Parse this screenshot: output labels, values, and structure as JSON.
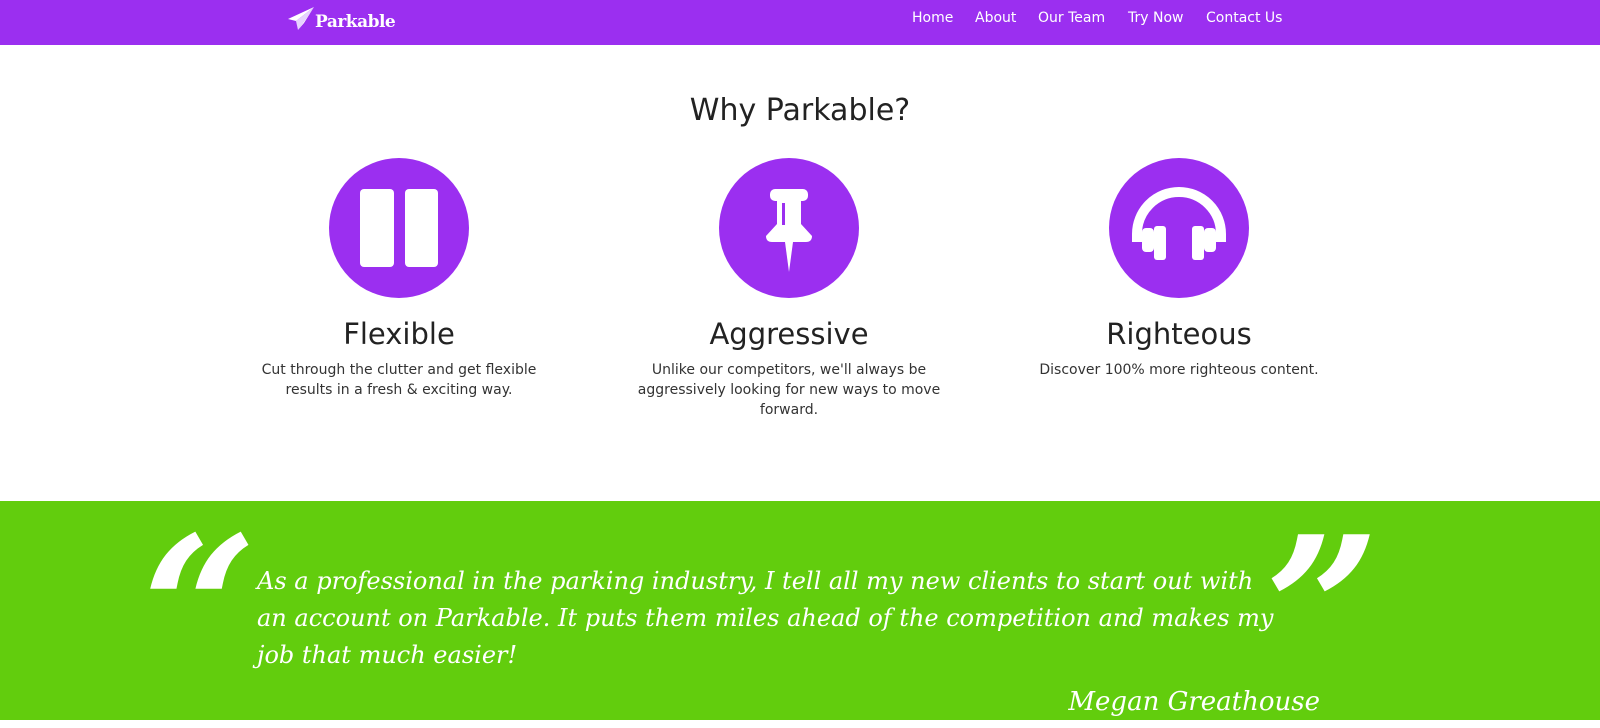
{
  "brand": {
    "name": "Parkable",
    "logo_icon": "paper-plane-icon"
  },
  "nav": {
    "items": [
      {
        "label": "Home"
      },
      {
        "label": "About"
      },
      {
        "label": "Our Team"
      },
      {
        "label": "Try Now"
      },
      {
        "label": "Contact Us"
      }
    ]
  },
  "features": {
    "title": "Why Parkable?",
    "items": [
      {
        "icon": "pause-icon",
        "title": "Flexible",
        "description": "Cut through the clutter and get flexible results in a fresh & exciting way."
      },
      {
        "icon": "pushpin-icon",
        "title": "Aggressive",
        "description": "Unlike our competitors, we'll always be aggressively looking for new ways to move forward."
      },
      {
        "icon": "headphones-icon",
        "title": "Righteous",
        "description": "Discover 100% more righteous content."
      }
    ]
  },
  "testimonial": {
    "quote": "As a professional in the parking industry, I tell all my new clients to start out with an account on Parkable. It puts them miles ahead of the competition and makes my job that much easier!",
    "author": "Megan Greathouse",
    "open_mark": "“",
    "close_mark": "”"
  },
  "colors": {
    "brand_purple": "#9b2ff0",
    "accent_green": "#62cd0d",
    "text_dark": "#222222"
  }
}
